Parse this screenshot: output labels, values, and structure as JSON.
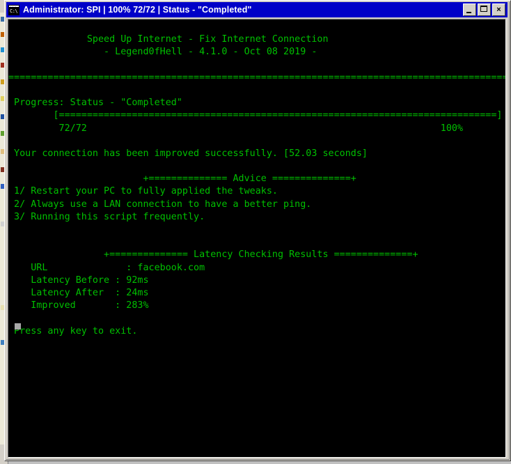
{
  "window": {
    "title": "Administrator:  SPI | 100% 72/72 | Status - \"Completed\"",
    "icon": "cmd-console-icon",
    "icon_prompt": "C:\\",
    "title_bar_color": "#0000c8",
    "buttons": {
      "minimize_label": "_",
      "maximize_label": "□",
      "close_label": "×"
    }
  },
  "console": {
    "foreground_color": "#00c000",
    "background_color": "#000000",
    "cursor": "block-cursor",
    "lines": [
      "",
      "              Speed Up Internet - Fix Internet Connection",
      "                 - Legend0fHell - 4.1.0 - Oct 08 2019 -",
      "",
      "================================================================================================",
      "",
      " Progress: Status - \"Completed\"",
      "        [==============================================================================]",
      "         72/72                                                               100%",
      "",
      " Your connection has been improved successfully. [52.03 seconds]",
      "",
      "                        +============== Advice ==============+",
      " 1/ Restart your PC to fully applied the tweaks.",
      " 2/ Always use a LAN connection to have a better ping.",
      " 3/ Running this script frequently.",
      "",
      "",
      "                 +============== Latency Checking Results ==============+",
      "    URL              : facebook.com",
      "    Latency Before : 92ms",
      "    Latency After  : 24ms",
      "    Improved       : 283%",
      "",
      " Press any key to exit."
    ],
    "details": {
      "app_title": "Speed Up Internet - Fix Internet Connection",
      "app_byline": "- Legend0fHell - 4.1.0 - Oct 08 2019 -",
      "version": "4.1.0",
      "author": "Legend0fHell",
      "build_date": "Oct 08 2019",
      "progress_label": "Progress: Status - \"Completed\"",
      "progress_status": "Completed",
      "progress_count": "72/72",
      "progress_percent": "100%",
      "result_message": "Your connection has been improved successfully. [52.03 seconds]",
      "elapsed_seconds": "52.03 seconds",
      "advice_header": "+============== Advice ==============+",
      "advice_title": "Advice",
      "advice_items": [
        "1/ Restart your PC to fully applied the tweaks.",
        "2/ Always use a LAN connection to have a better ping.",
        "3/ Running this script frequently."
      ],
      "latency_header": "+============== Latency Checking Results ==============+",
      "latency_title": "Latency Checking Results",
      "latency_rows": [
        {
          "label": "URL",
          "value": "facebook.com"
        },
        {
          "label": "Latency Before",
          "value": "92ms"
        },
        {
          "label": "Latency After",
          "value": "24ms"
        },
        {
          "label": "Improved",
          "value": "283%"
        }
      ],
      "exit_prompt": "Press any key to exit."
    }
  },
  "desktop": {
    "background_color": "#c0c0c0",
    "strip_color": "#ece9d8"
  }
}
